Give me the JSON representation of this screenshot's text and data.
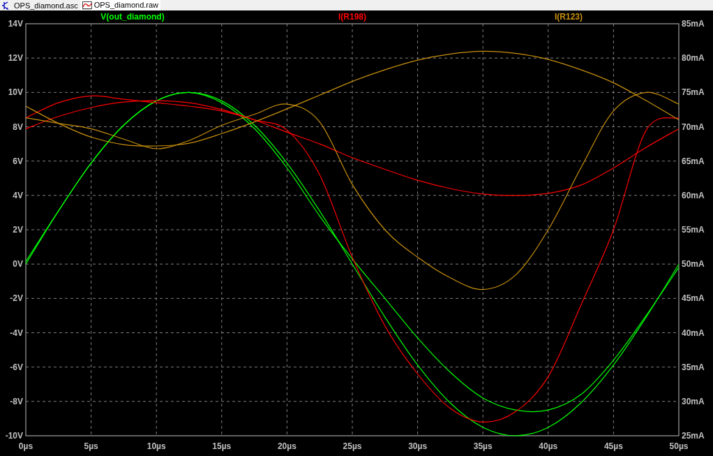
{
  "tabs": [
    {
      "label": "OPS_diamond.asc",
      "kind": "schematic",
      "selected": false
    },
    {
      "label": "OPS_diamond.raw",
      "kind": "waveform",
      "selected": true
    }
  ],
  "plot": {
    "chart_data": {
      "type": "line",
      "x": [
        0,
        2.5,
        5,
        7.5,
        10,
        12.5,
        15,
        17.5,
        20,
        22.5,
        25,
        27.5,
        30,
        32.5,
        35,
        37.5,
        40,
        42.5,
        45,
        47.5,
        50
      ],
      "grid": true,
      "xlim": [
        0,
        50
      ],
      "ylim": [
        -10,
        14
      ],
      "y2lim": [
        25,
        85
      ],
      "xticks": [
        {
          "value": 0,
          "label": "0µs"
        },
        {
          "value": 5,
          "label": "5µs"
        },
        {
          "value": 10,
          "label": "10µs"
        },
        {
          "value": 15,
          "label": "15µs"
        },
        {
          "value": 20,
          "label": "20µs"
        },
        {
          "value": 25,
          "label": "25µs"
        },
        {
          "value": 30,
          "label": "30µs"
        },
        {
          "value": 35,
          "label": "35µs"
        },
        {
          "value": 40,
          "label": "40µs"
        },
        {
          "value": 45,
          "label": "45µs"
        },
        {
          "value": 50,
          "label": "50µs"
        }
      ],
      "yticks": [
        {
          "value": 14,
          "label": "14V"
        },
        {
          "value": 12,
          "label": "12V"
        },
        {
          "value": 10,
          "label": "10V"
        },
        {
          "value": 8,
          "label": "8V"
        },
        {
          "value": 6,
          "label": "6V"
        },
        {
          "value": 4,
          "label": "4V"
        },
        {
          "value": 2,
          "label": "2V"
        },
        {
          "value": 0,
          "label": "0V"
        },
        {
          "value": -2,
          "label": "-2V"
        },
        {
          "value": -4,
          "label": "-4V"
        },
        {
          "value": -6,
          "label": "-6V"
        },
        {
          "value": -8,
          "label": "-8V"
        },
        {
          "value": -10,
          "label": "-10V"
        }
      ],
      "y2ticks": [
        {
          "value": 85,
          "label": "85mA"
        },
        {
          "value": 80,
          "label": "80mA"
        },
        {
          "value": 75,
          "label": "75mA"
        },
        {
          "value": 70,
          "label": "70mA"
        },
        {
          "value": 65,
          "label": "65mA"
        },
        {
          "value": 60,
          "label": "60mA"
        },
        {
          "value": 55,
          "label": "55mA"
        },
        {
          "value": 50,
          "label": "50mA"
        },
        {
          "value": 45,
          "label": "45mA"
        },
        {
          "value": 40,
          "label": "40mA"
        },
        {
          "value": 35,
          "label": "35mA"
        },
        {
          "value": 30,
          "label": "30mA"
        },
        {
          "value": 25,
          "label": "25mA"
        }
      ],
      "series": [
        {
          "name": "V(out_diamond)",
          "color": "#00ff00",
          "values": [
            0,
            3.09,
            5.88,
            8.09,
            9.51,
            10,
            9.51,
            8.09,
            5.88,
            3.09,
            0,
            -3.09,
            -5.88,
            -8.09,
            -9.51,
            -10,
            -9.51,
            -8.09,
            -5.88,
            -3.09,
            0
          ]
        },
        {
          "color": "#00ff00",
          "values": [
            0.15,
            3.09,
            5.88,
            8.09,
            9.51,
            10,
            9.4,
            7.9,
            5.6,
            2.8,
            0.3,
            -2.0,
            -4.3,
            -6.3,
            -7.8,
            -8.5,
            -8.5,
            -7.6,
            -5.6,
            -3.0,
            -0.2
          ]
        },
        {
          "name": "I(R198)",
          "color": "#ff0000",
          "axis": "y2",
          "values": [
            71.3,
            73.5,
            74.5,
            74,
            73.5,
            73,
            72.3,
            71,
            69.5,
            63,
            51,
            41,
            34,
            29,
            27,
            28.5,
            33.6,
            44,
            55,
            69.5,
            71.3
          ]
        },
        {
          "color": "#ff0000",
          "axis": "y2",
          "values": [
            69.7,
            71.5,
            72.8,
            73.6,
            73.8,
            73.5,
            72.5,
            71,
            69.2,
            67.5,
            65.5,
            63.8,
            62.2,
            61,
            60.2,
            60,
            60.3,
            61.5,
            64,
            67,
            69.7
          ]
        },
        {
          "name": "I(R123)",
          "color": "#c8900c",
          "axis": "y2",
          "values": [
            73,
            70.5,
            68.5,
            67.4,
            67.2,
            67.6,
            69,
            70.7,
            72.6,
            74.6,
            76.6,
            78.3,
            79.7,
            80.6,
            81,
            80.7,
            79.8,
            78.3,
            76.4,
            73.8,
            71
          ]
        },
        {
          "color": "#c8900c",
          "axis": "y2",
          "values": [
            71.3,
            70.5,
            69.7,
            68.2,
            66.8,
            68,
            70.2,
            71.8,
            73.3,
            70.7,
            61.6,
            55,
            51,
            48,
            46.3,
            48.4,
            55,
            64,
            72.3,
            75,
            73.3
          ]
        }
      ]
    }
  }
}
